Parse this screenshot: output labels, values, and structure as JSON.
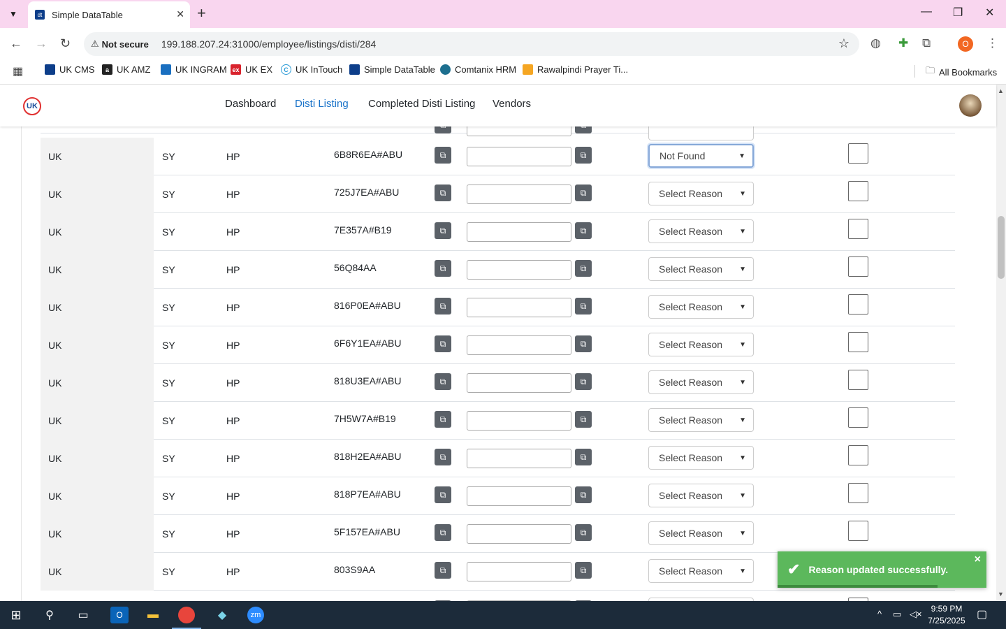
{
  "browser": {
    "tab_title": "Simple DataTable",
    "not_secure": "Not secure",
    "url": "199.188.207.24:31000/employee/listings/disti/284",
    "profile_initial": "O",
    "bookmarks": [
      "UK CMS",
      "UK AMZ",
      "UK INGRAM",
      "UK EX",
      "UK InTouch",
      "Simple DataTable",
      "Comtanix HRM",
      "Rawalpindi Prayer Ti..."
    ],
    "all_bookmarks": "All Bookmarks"
  },
  "app": {
    "logo_text": "UK",
    "nav": [
      "Dashboard",
      "Disti Listing",
      "Completed Disti Listing",
      "Vendors"
    ],
    "active_nav": "Disti Listing"
  },
  "table": {
    "rows": [
      {
        "country": "UK",
        "code": "SY",
        "brand": "HP",
        "sku": "6B8R6EA#ABU",
        "reason": "Not Found"
      },
      {
        "country": "UK",
        "code": "SY",
        "brand": "HP",
        "sku": "725J7EA#ABU",
        "reason": "Select Reason"
      },
      {
        "country": "UK",
        "code": "SY",
        "brand": "HP",
        "sku": "7E357A#B19",
        "reason": "Select Reason"
      },
      {
        "country": "UK",
        "code": "SY",
        "brand": "HP",
        "sku": "56Q84AA",
        "reason": "Select Reason"
      },
      {
        "country": "UK",
        "code": "SY",
        "brand": "HP",
        "sku": "816P0EA#ABU",
        "reason": "Select Reason"
      },
      {
        "country": "UK",
        "code": "SY",
        "brand": "HP",
        "sku": "6F6Y1EA#ABU",
        "reason": "Select Reason"
      },
      {
        "country": "UK",
        "code": "SY",
        "brand": "HP",
        "sku": "818U3EA#ABU",
        "reason": "Select Reason"
      },
      {
        "country": "UK",
        "code": "SY",
        "brand": "HP",
        "sku": "7H5W7A#B19",
        "reason": "Select Reason"
      },
      {
        "country": "UK",
        "code": "SY",
        "brand": "HP",
        "sku": "818H2EA#ABU",
        "reason": "Select Reason"
      },
      {
        "country": "UK",
        "code": "SY",
        "brand": "HP",
        "sku": "818P7EA#ABU",
        "reason": "Select Reason"
      },
      {
        "country": "UK",
        "code": "SY",
        "brand": "HP",
        "sku": "5F157EA#ABU",
        "reason": "Select Reason"
      },
      {
        "country": "UK",
        "code": "SY",
        "brand": "HP",
        "sku": "803S9AA",
        "reason": "Select Reason"
      }
    ]
  },
  "toast": {
    "message": "Reason updated successfully.",
    "close": "×"
  },
  "taskbar": {
    "time": "9:59 PM",
    "date": "7/25/2025"
  },
  "colors": {
    "toast": "#5cb85c",
    "active_nav": "#1a73c9",
    "tabstrip": "#f9d6ef"
  }
}
